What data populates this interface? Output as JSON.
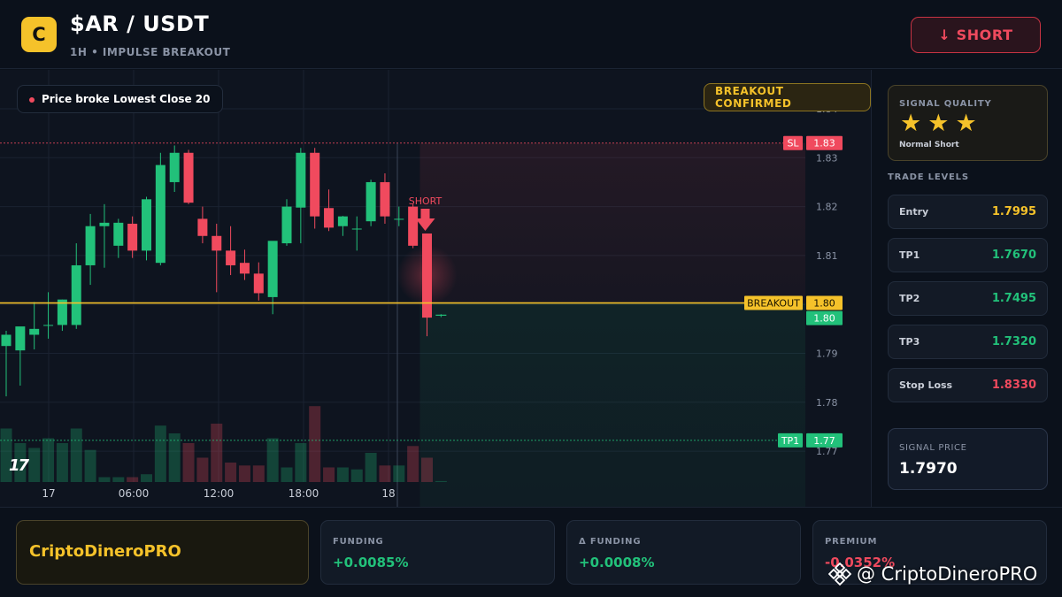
{
  "header": {
    "logo_letter": "C",
    "pair": "$AR / USDT",
    "subtitle": "1H • IMPULSE BREAKOUT",
    "action_button": "↓ SHORT"
  },
  "chart": {
    "alert_text": "Price broke Lowest Close 20",
    "breakout_badge": "BREAKOUT CONFIRMED",
    "short_marker": "SHORT",
    "tv_logo": "17",
    "price_ticks": [
      "1.84",
      "1.83",
      "1.82",
      "1.81",
      "1.80",
      "1.79",
      "1.78",
      "1.77"
    ],
    "time_ticks": [
      "17",
      "06:00",
      "12:00",
      "18:00",
      "18"
    ],
    "lines": {
      "sl": {
        "label": "SL",
        "value": "1.83"
      },
      "breakout": {
        "label": "BREAKOUT",
        "value": "1.80"
      },
      "tp1": {
        "label": "TP1",
        "value": "1.77"
      },
      "last_price": "1.80"
    },
    "colors": {
      "up": "#22c17a",
      "down": "#f04a5e",
      "breakout": "#f5c22a"
    }
  },
  "chart_data": {
    "type": "candlestick",
    "x_labels": [
      "17",
      "06:00",
      "12:00",
      "18:00",
      "18"
    ],
    "ylim": [
      1.7685,
      1.841
    ],
    "candles": [
      {
        "o": 1.7915,
        "h": 1.7946,
        "l": 1.7812,
        "c": 1.7938
      },
      {
        "o": 1.7906,
        "h": 1.7948,
        "l": 1.7834,
        "c": 1.7955
      },
      {
        "o": 1.7938,
        "h": 1.8005,
        "l": 1.7908,
        "c": 1.795
      },
      {
        "o": 1.7958,
        "h": 1.8025,
        "l": 1.793,
        "c": 1.7958
      },
      {
        "o": 1.7958,
        "h": 1.801,
        "l": 1.7946,
        "c": 1.801
      },
      {
        "o": 1.7958,
        "h": 1.8125,
        "l": 1.795,
        "c": 1.808
      },
      {
        "o": 1.808,
        "h": 1.8185,
        "l": 1.804,
        "c": 1.816
      },
      {
        "o": 1.816,
        "h": 1.8205,
        "l": 1.8075,
        "c": 1.8167
      },
      {
        "o": 1.812,
        "h": 1.8175,
        "l": 1.8095,
        "c": 1.8167
      },
      {
        "o": 1.8165,
        "h": 1.818,
        "l": 1.8095,
        "c": 1.811
      },
      {
        "o": 1.811,
        "h": 1.822,
        "l": 1.809,
        "c": 1.8215
      },
      {
        "o": 1.8085,
        "h": 1.831,
        "l": 1.808,
        "c": 1.8285
      },
      {
        "o": 1.825,
        "h": 1.8325,
        "l": 1.823,
        "c": 1.831
      },
      {
        "o": 1.831,
        "h": 1.8316,
        "l": 1.8205,
        "c": 1.8208
      },
      {
        "o": 1.8175,
        "h": 1.82,
        "l": 1.8125,
        "c": 1.814
      },
      {
        "o": 1.814,
        "h": 1.8165,
        "l": 1.8025,
        "c": 1.811
      },
      {
        "o": 1.811,
        "h": 1.816,
        "l": 1.806,
        "c": 1.808
      },
      {
        "o": 1.8085,
        "h": 1.8112,
        "l": 1.805,
        "c": 1.8063
      },
      {
        "o": 1.8063,
        "h": 1.8086,
        "l": 1.8008,
        "c": 1.8023
      },
      {
        "o": 1.8015,
        "h": 1.8125,
        "l": 1.798,
        "c": 1.813
      },
      {
        "o": 1.8125,
        "h": 1.8215,
        "l": 1.812,
        "c": 1.82
      },
      {
        "o": 1.8198,
        "h": 1.832,
        "l": 1.8125,
        "c": 1.831
      },
      {
        "o": 1.831,
        "h": 1.832,
        "l": 1.8155,
        "c": 1.818
      },
      {
        "o": 1.8197,
        "h": 1.8235,
        "l": 1.815,
        "c": 1.8157
      },
      {
        "o": 1.816,
        "h": 1.8181,
        "l": 1.814,
        "c": 1.818
      },
      {
        "o": 1.8155,
        "h": 1.818,
        "l": 1.811,
        "c": 1.8155
      },
      {
        "o": 1.817,
        "h": 1.8255,
        "l": 1.816,
        "c": 1.825
      },
      {
        "o": 1.825,
        "h": 1.8268,
        "l": 1.8165,
        "c": 1.818
      },
      {
        "o": 1.8175,
        "h": 1.82,
        "l": 1.816,
        "c": 1.8175
      },
      {
        "o": 1.82,
        "h": 1.8205,
        "l": 1.8115,
        "c": 1.812
      },
      {
        "o": 1.8145,
        "h": 1.8145,
        "l": 1.7935,
        "c": 1.7973
      },
      {
        "o": 1.7975,
        "h": 1.798,
        "l": 1.7974,
        "c": 1.7978
      }
    ],
    "volumes": [
      0.55,
      0.4,
      0.35,
      0.45,
      0.4,
      0.55,
      0.33,
      0.05,
      0.05,
      0.05,
      0.08,
      0.58,
      0.5,
      0.4,
      0.25,
      0.6,
      0.2,
      0.17,
      0.17,
      0.45,
      0.15,
      0.4,
      0.78,
      0.15,
      0.15,
      0.13,
      0.3,
      0.17,
      0.17,
      0.37,
      0.25,
      0.01
    ],
    "levels": {
      "sl": 1.833,
      "breakout": 1.8003,
      "tp1": 1.7722,
      "last": 1.7978
    },
    "signal_index": 30
  },
  "sidebar": {
    "quality_title": "SIGNAL QUALITY",
    "stars": 3,
    "quality_label": "Normal Short",
    "levels_title": "TRADE LEVELS",
    "levels": [
      {
        "name": "Entry",
        "value": "1.7995",
        "color": "#f5c22a"
      },
      {
        "name": "TP1",
        "value": "1.7670",
        "color": "#22c17a"
      },
      {
        "name": "TP2",
        "value": "1.7495",
        "color": "#22c17a"
      },
      {
        "name": "TP3",
        "value": "1.7320",
        "color": "#22c17a"
      },
      {
        "name": "Stop Loss",
        "value": "1.8330",
        "color": "#f04a5e"
      }
    ],
    "signal_price_title": "SIGNAL PRICE",
    "signal_price": "1.7970"
  },
  "footer": {
    "brand": "CriptoDineroPRO",
    "metrics": [
      {
        "title": "FUNDING",
        "value": "+0.0085%",
        "color": "#22c17a"
      },
      {
        "title": "Δ FUNDING",
        "value": "+0.0008%",
        "color": "#22c17a"
      },
      {
        "title": "PREMIUM",
        "value": "-0.0352%",
        "color": "#f04a5e"
      }
    ],
    "watermark": "@ CriptoDineroPRO"
  }
}
